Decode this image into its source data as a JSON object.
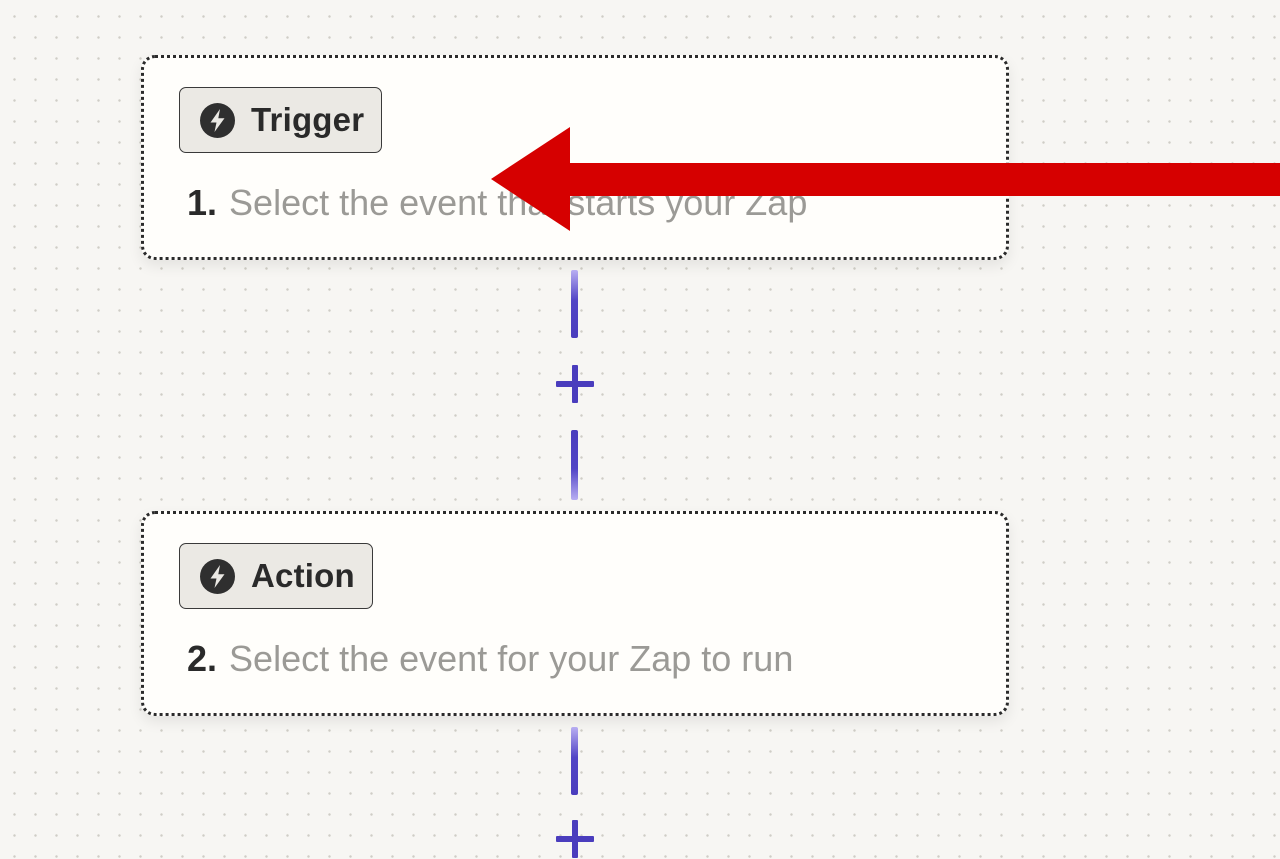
{
  "steps": [
    {
      "badge_label": "Trigger",
      "badge_icon": "bolt-icon",
      "number": "1.",
      "description": "Select the event that starts your Zap"
    },
    {
      "badge_label": "Action",
      "badge_icon": "bolt-icon",
      "number": "2.",
      "description": "Select the event for your Zap to run"
    }
  ],
  "add_step_icon": "plus-icon",
  "colors": {
    "canvas_background": "#f7f6f3",
    "card_background": "#fffefb",
    "connector_purple": "#4a3dbd",
    "annotation_red": "#d60000",
    "description_gray": "#9b9a96"
  },
  "annotation": {
    "type": "arrow",
    "direction": "left",
    "points_to": "trigger-step-card"
  }
}
